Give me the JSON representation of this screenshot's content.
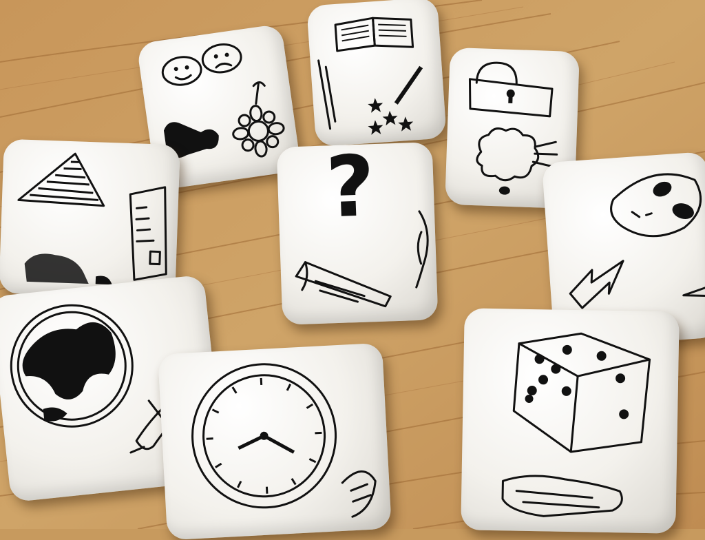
{
  "scene": {
    "description_visible_text": "?",
    "table_color": "#c79a5e",
    "die_color": "#f4f2ee",
    "ink_color": "#111111"
  },
  "dice": [
    {
      "name": "die-faces-flower",
      "symbols": [
        "masks-icon",
        "bone-icon",
        "flower-icon"
      ]
    },
    {
      "name": "die-book-wand",
      "symbols": [
        "open-book-icon",
        "magic-wand-icon",
        "bridge-icon"
      ]
    },
    {
      "name": "die-padlock-sheep",
      "symbols": [
        "padlock-icon",
        "sheep-icon"
      ]
    },
    {
      "name": "die-pyramid-card",
      "symbols": [
        "pyramid-icon",
        "id-card-icon",
        "hedgehog-icon"
      ]
    },
    {
      "name": "die-question-cheese",
      "symbols": [
        "question-mark",
        "cheese-icon",
        "shell-icon"
      ],
      "question_text": "?"
    },
    {
      "name": "die-alien-lightning",
      "symbols": [
        "alien-face-icon",
        "lightning-icon",
        "arrow-icon"
      ]
    },
    {
      "name": "die-globe-plane",
      "symbols": [
        "globe-icon",
        "airplane-icon"
      ]
    },
    {
      "name": "die-clock-fish",
      "symbols": [
        "clock-icon",
        "fish-icon"
      ]
    },
    {
      "name": "die-dice-hand",
      "symbols": [
        "dice-icon",
        "hand-icon"
      ]
    }
  ]
}
